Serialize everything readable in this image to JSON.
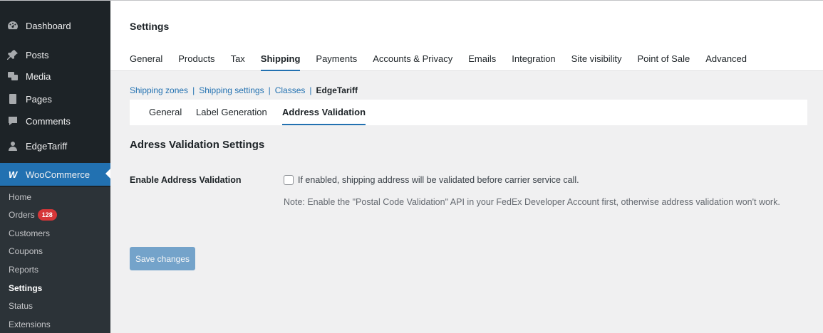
{
  "sidebar": {
    "items": [
      {
        "label": "Dashboard",
        "icon": "dashboard-icon"
      },
      {
        "label": "Posts",
        "icon": "pin-icon"
      },
      {
        "label": "Media",
        "icon": "media-icon"
      },
      {
        "label": "Pages",
        "icon": "pages-icon"
      },
      {
        "label": "Comments",
        "icon": "comment-icon"
      },
      {
        "label": "EdgeTariff",
        "icon": "user-icon"
      },
      {
        "label": "WooCommerce",
        "icon": "woocommerce-icon"
      }
    ],
    "submenu": [
      {
        "label": "Home"
      },
      {
        "label": "Orders",
        "badge": "128"
      },
      {
        "label": "Customers"
      },
      {
        "label": "Coupons"
      },
      {
        "label": "Reports"
      },
      {
        "label": "Settings"
      },
      {
        "label": "Status"
      },
      {
        "label": "Extensions"
      }
    ],
    "woo_icon_glyph": "W"
  },
  "header": {
    "title": "Settings",
    "tabs": [
      "General",
      "Products",
      "Tax",
      "Shipping",
      "Payments",
      "Accounts & Privacy",
      "Emails",
      "Integration",
      "Site visibility",
      "Point of Sale",
      "Advanced"
    ],
    "active_tab": "Shipping"
  },
  "sublinks": {
    "items": [
      "Shipping zones",
      "Shipping settings",
      "Classes",
      "EdgeTariff"
    ],
    "separator": "|"
  },
  "subtabs": {
    "items": [
      "General",
      "Label Generation",
      "Address Validation"
    ],
    "active": "Address Validation"
  },
  "section": {
    "title": "Adress Validation Settings",
    "field_label": "Enable Address Validation",
    "checkbox_checked": false,
    "checkbox_desc": "If enabled, shipping address will be validated before carrier service call.",
    "note": "Note: Enable the \"Postal Code Validation\" API in your FedEx Developer Account first, otherwise address validation won't work."
  },
  "actions": {
    "save_label": "Save changes"
  },
  "colors": {
    "sidebar_bg": "#1d2327",
    "submenu_bg": "#2c3338",
    "accent": "#2271b1",
    "badge": "#d63638",
    "content_bg": "#f0f0f1"
  }
}
